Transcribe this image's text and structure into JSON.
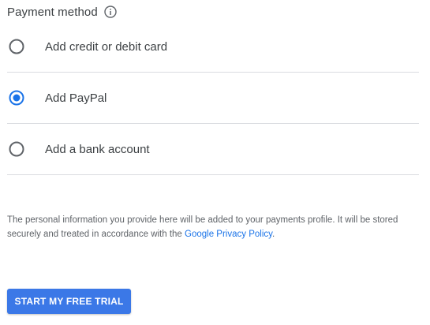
{
  "header": {
    "title": "Payment method",
    "info_icon": "info-circle-icon"
  },
  "payment_options": [
    {
      "label": "Add credit or debit card",
      "selected": false
    },
    {
      "label": "Add PayPal",
      "selected": true
    },
    {
      "label": "Add a bank account",
      "selected": false
    }
  ],
  "notice": {
    "text_before": "The personal information you provide here will be added to your payments profile. It will be stored securely and treated in accordance with the ",
    "link_text": "Google Privacy Policy",
    "text_after": "."
  },
  "cta": {
    "label": "START MY FREE TRIAL"
  },
  "colors": {
    "accent": "#1a73e8",
    "button": "#3b78e7",
    "divider": "#dadce0",
    "text": "#3c4043",
    "muted_text": "#5f6368"
  }
}
